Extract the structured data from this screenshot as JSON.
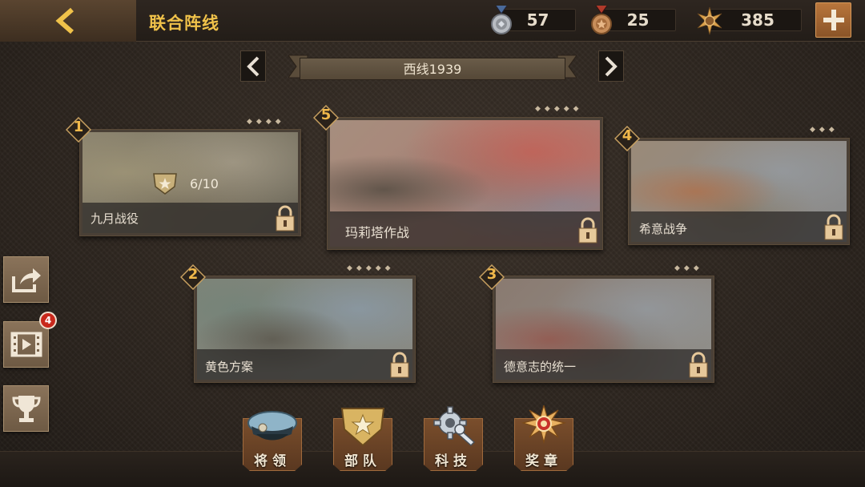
{
  "header": {
    "title": "联合阵线"
  },
  "resources": {
    "silver_medals": "57",
    "bronze_medals": "25",
    "gold_emblems": "385"
  },
  "campaign": {
    "name": "西线1939"
  },
  "missions": [
    {
      "number": "1",
      "name": "九月战役",
      "progress": "6/10"
    },
    {
      "number": "5",
      "name": "玛莉塔作战"
    },
    {
      "number": "4",
      "name": "希意战争"
    },
    {
      "number": "2",
      "name": "黄色方案"
    },
    {
      "number": "3",
      "name": "德意志的统一"
    }
  ],
  "side": {
    "video_badge": "4"
  },
  "bottom_menu": [
    {
      "label": "将领"
    },
    {
      "label": "部队"
    },
    {
      "label": "科技"
    },
    {
      "label": "奖章"
    }
  ],
  "colors": {
    "title": "#f0c24a",
    "accent_button": "#a8683a",
    "notification": "#c8281c"
  }
}
